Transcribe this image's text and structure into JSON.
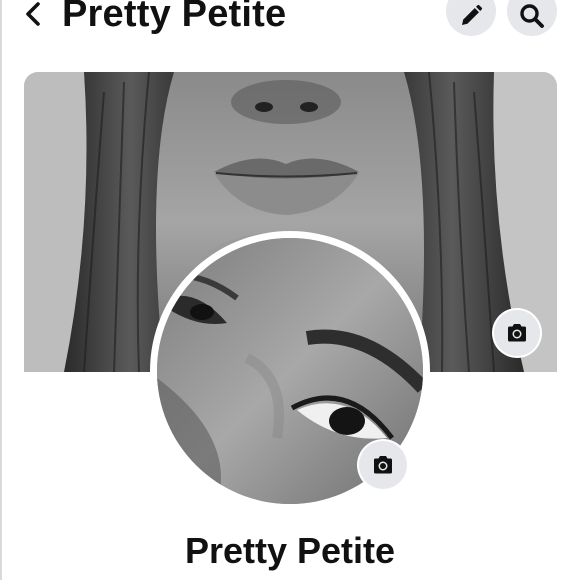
{
  "header": {
    "title": "Pretty Petite",
    "back_icon": "chevron-left-icon",
    "edit_icon": "pencil-icon",
    "search_icon": "search-icon"
  },
  "cover_photo": {
    "camera_icon": "camera-icon"
  },
  "profile": {
    "name": "Pretty Petite",
    "camera_icon": "camera-icon"
  },
  "colors": {
    "button_bg": "#e6e7eb",
    "text": "#111111",
    "background": "#ffffff"
  }
}
